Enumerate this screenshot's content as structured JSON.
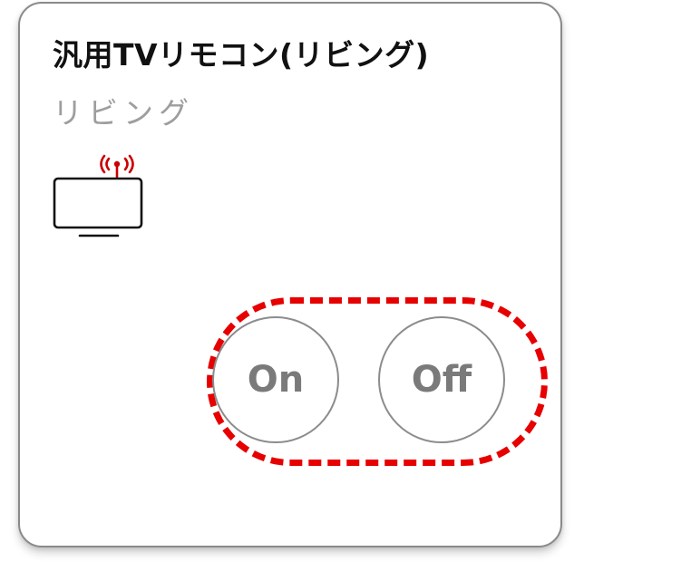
{
  "card": {
    "title": "汎用TVリモコン(リビング)",
    "room": "リビング"
  },
  "icons": {
    "device": "tv-remote-signal-icon"
  },
  "controls": {
    "on_label": "On",
    "off_label": "Off"
  },
  "colors": {
    "highlight": "#e60000",
    "signal": "#cc0000",
    "button_text": "#7a7a7a",
    "subtitle": "#9e9e9e"
  }
}
